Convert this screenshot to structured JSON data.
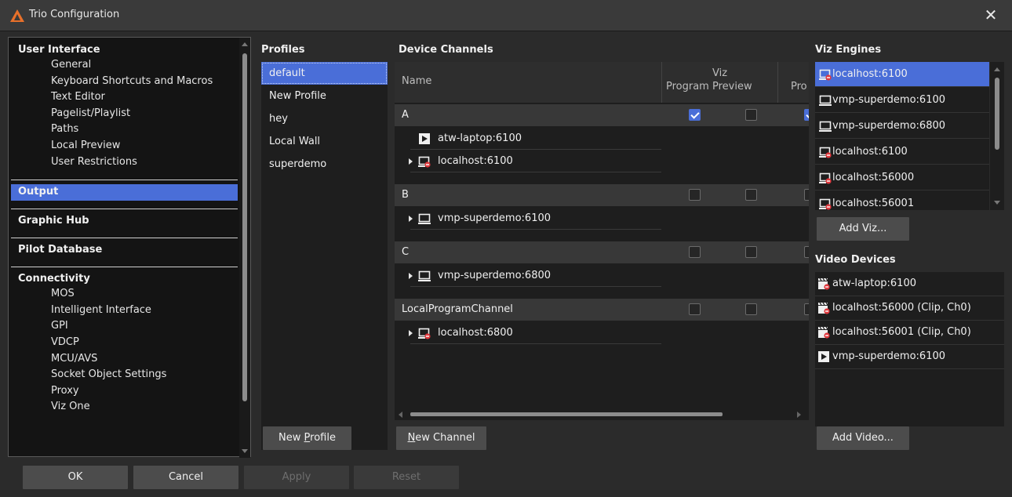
{
  "window": {
    "title": "Trio Configuration",
    "close_glyph": "✕"
  },
  "nav": {
    "sections": [
      {
        "heading": "User Interface",
        "items": [
          "General",
          "Keyboard Shortcuts and Macros",
          "Text Editor",
          "Pagelist/Playlist",
          "Paths",
          "Local Preview",
          "User Restrictions"
        ]
      },
      {
        "heading": "Output",
        "items": []
      },
      {
        "heading": "Graphic Hub",
        "items": []
      },
      {
        "heading": "Pilot Database",
        "items": []
      },
      {
        "heading": "Connectivity",
        "items": [
          "MOS",
          "Intelligent Interface",
          "GPI",
          "VDCP",
          "MCU/AVS",
          "Socket Object Settings",
          "Proxy",
          "Viz One"
        ]
      }
    ],
    "selected": "Output"
  },
  "profiles": {
    "label": "Profiles",
    "items": [
      "default",
      "New Profile",
      "hey",
      "Local Wall",
      "superdemo"
    ],
    "selected": "default",
    "new_button_prefix": "New ",
    "new_button_underlined": "P",
    "new_button_suffix": "rofile"
  },
  "channels": {
    "label": "Device Channels",
    "columns": {
      "name": "Name",
      "group": "Viz",
      "program": "Program",
      "preview": "Preview",
      "truncated": "Pro"
    },
    "groups": [
      {
        "name": "A",
        "program": true,
        "preview": false,
        "extra": true,
        "devices": [
          {
            "label": "atw-laptop:6100",
            "icon": "video-clip-icon",
            "expand": false
          },
          {
            "label": "localhost:6100",
            "icon": "viz-engine-error-icon",
            "expand": true
          }
        ]
      },
      {
        "name": "B",
        "program": false,
        "preview": false,
        "extra": false,
        "devices": [
          {
            "label": "vmp-superdemo:6100",
            "icon": "monitor-icon",
            "expand": true
          }
        ]
      },
      {
        "name": "C",
        "program": false,
        "preview": false,
        "extra": false,
        "devices": [
          {
            "label": "vmp-superdemo:6800",
            "icon": "monitor-icon",
            "expand": true
          }
        ]
      },
      {
        "name": "LocalProgramChannel",
        "program": false,
        "preview": false,
        "extra": false,
        "devices": [
          {
            "label": "localhost:6800",
            "icon": "viz-engine-error-icon",
            "expand": true
          }
        ]
      }
    ],
    "new_button_underlined": "N",
    "new_button_suffix": "ew Channel"
  },
  "viz_engines": {
    "label": "Viz Engines",
    "items": [
      {
        "label": "localhost:6100",
        "icon": "viz-engine-error-icon"
      },
      {
        "label": "vmp-superdemo:6100",
        "icon": "monitor-icon"
      },
      {
        "label": "vmp-superdemo:6800",
        "icon": "monitor-icon"
      },
      {
        "label": "localhost:6100",
        "icon": "viz-engine-error-icon"
      },
      {
        "label": "localhost:56000",
        "icon": "viz-engine-error-icon"
      },
      {
        "label": "localhost:56001",
        "icon": "viz-engine-error-icon"
      }
    ],
    "selected_index": 0,
    "add_button": "Add Viz..."
  },
  "video_devices": {
    "label": "Video Devices",
    "items": [
      {
        "label": "atw-laptop:6100",
        "icon": "video-clip-error-icon"
      },
      {
        "label": "localhost:56000 (Clip, Ch0)",
        "icon": "video-clip-error-icon"
      },
      {
        "label": "localhost:56001 (Clip, Ch0)",
        "icon": "video-clip-error-icon"
      },
      {
        "label": "vmp-superdemo:6100",
        "icon": "video-clip-icon"
      }
    ],
    "add_button": "Add Video..."
  },
  "footer": {
    "ok": "OK",
    "cancel": "Cancel",
    "apply": "Apply",
    "reset": "Reset"
  },
  "colors": {
    "accent": "#4a6ed8",
    "background": "#2b2b2b",
    "list": "#1e1e1e",
    "error": "#e0393e"
  }
}
